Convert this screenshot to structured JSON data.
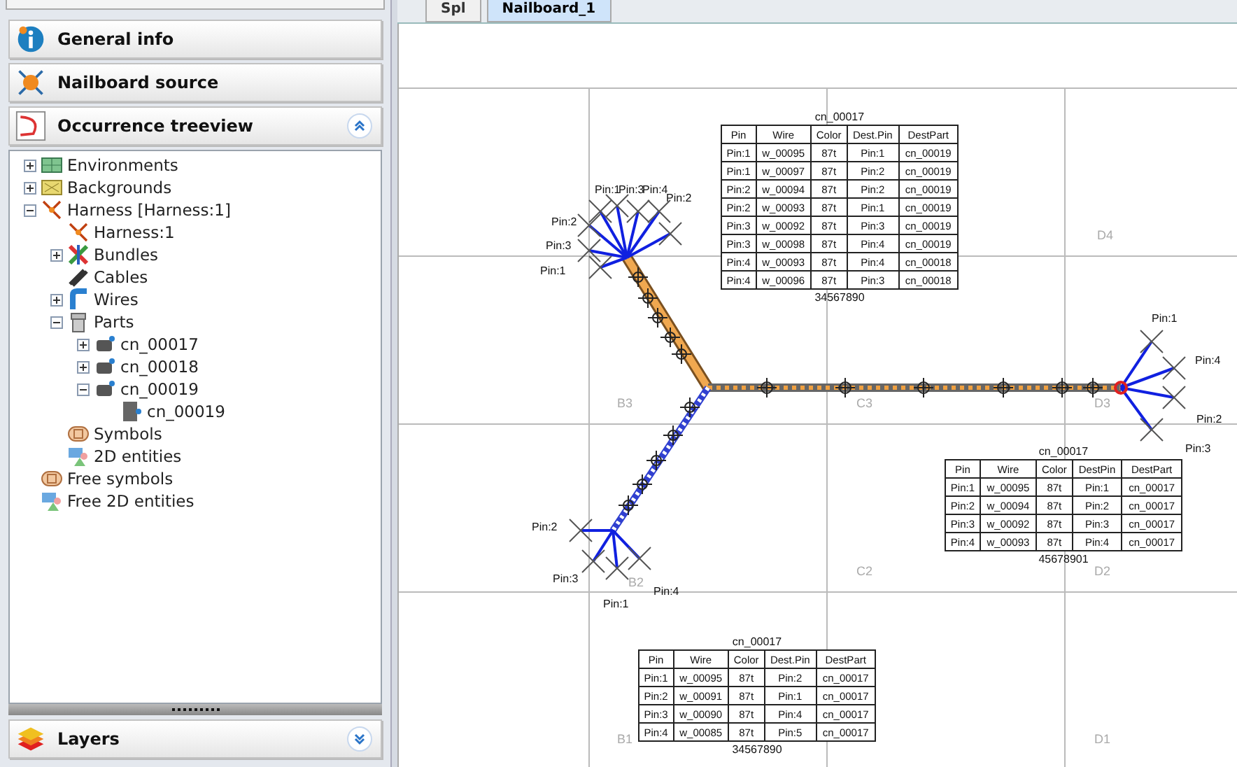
{
  "panel": {
    "sections": [
      {
        "kind": "info",
        "title": "General info"
      },
      {
        "kind": "source",
        "title": "Nailboard source"
      },
      {
        "kind": "tree",
        "title": "Occurrence treeview",
        "expanded": true
      }
    ],
    "footer_sections": [
      {
        "kind": "layers",
        "title": "Layers",
        "expanded": false
      }
    ]
  },
  "tree": {
    "items": [
      {
        "kind": "environment",
        "label": "Environments",
        "expanded": false
      },
      {
        "kind": "background",
        "label": "Backgrounds",
        "expanded": false
      },
      {
        "kind": "harness",
        "label": "Harness [Harness:1]",
        "expanded": true,
        "children": [
          {
            "kind": "harness",
            "label": "Harness:1"
          },
          {
            "kind": "bundle",
            "label": "Bundles",
            "expanded": false
          },
          {
            "kind": "cable",
            "label": "Cables"
          },
          {
            "kind": "wire",
            "label": "Wires",
            "expanded": false
          },
          {
            "kind": "part",
            "label": "Parts",
            "expanded": true,
            "children": [
              {
                "kind": "connector",
                "label": "cn_00017",
                "expanded": false
              },
              {
                "kind": "connector",
                "label": "cn_00018",
                "expanded": false
              },
              {
                "kind": "connector",
                "label": "cn_00019",
                "expanded": true,
                "children": [
                  {
                    "kind": "pin",
                    "label": "cn_00019"
                  }
                ]
              }
            ]
          },
          {
            "kind": "symbol",
            "label": "Symbols"
          },
          {
            "kind": "entity",
            "label": "2D entities"
          }
        ]
      },
      {
        "kind": "symbol",
        "label": "Free symbols"
      },
      {
        "kind": "entity",
        "label": "Free 2D entities"
      }
    ]
  },
  "tabs": [
    {
      "label": "Spl",
      "selected": false
    },
    {
      "label": "Nailboard_1",
      "selected": true
    }
  ],
  "drawing": {
    "zone_labels": [
      "D4",
      "B3",
      "C3",
      "D3",
      "B2",
      "C2",
      "D2",
      "B1",
      "D1"
    ],
    "connectors": [
      {
        "pin_labels": [
          "Pin:1",
          "Pin:3",
          "Pin:4",
          "Pin:2",
          "Pin:2",
          "Pin:3",
          "Pin:1"
        ]
      },
      {
        "pin_labels": [
          "Pin:1",
          "Pin:4",
          "Pin:2",
          "Pin:3"
        ]
      },
      {
        "pin_labels": [
          "Pin:2",
          "Pin:3",
          "Pin:4",
          "Pin:1"
        ]
      }
    ],
    "tables": [
      {
        "title": "cn_00017",
        "columns": [
          "Pin",
          "Wire",
          "Color",
          "Dest.Pin",
          "DestPart"
        ],
        "rows": [
          [
            "Pin:1",
            "w_00095",
            "87t",
            "Pin:1",
            "cn_00019"
          ],
          [
            "Pin:1",
            "w_00097",
            "87t",
            "Pin:2",
            "cn_00019"
          ],
          [
            "Pin:2",
            "w_00094",
            "87t",
            "Pin:2",
            "cn_00019"
          ],
          [
            "Pin:2",
            "w_00093",
            "87t",
            "Pin:1",
            "cn_00019"
          ],
          [
            "Pin:3",
            "w_00092",
            "87t",
            "Pin:3",
            "cn_00019"
          ],
          [
            "Pin:3",
            "w_00098",
            "87t",
            "Pin:4",
            "cn_00019"
          ],
          [
            "Pin:4",
            "w_00093",
            "87t",
            "Pin:4",
            "cn_00018"
          ],
          [
            "Pin:4",
            "w_00096",
            "87t",
            "Pin:3",
            "cn_00018"
          ]
        ],
        "footer": "34567890"
      },
      {
        "title": "cn_00017",
        "columns": [
          "Pin",
          "Wire",
          "Color",
          "DestPin",
          "DestPart"
        ],
        "rows": [
          [
            "Pin:1",
            "w_00095",
            "87t",
            "Pin:1",
            "cn_00017"
          ],
          [
            "Pin:2",
            "w_00094",
            "87t",
            "Pin:2",
            "cn_00017"
          ],
          [
            "Pin:3",
            "w_00092",
            "87t",
            "Pin:3",
            "cn_00017"
          ],
          [
            "Pin:4",
            "w_00093",
            "87t",
            "Pin:4",
            "cn_00017"
          ]
        ],
        "footer": "45678901"
      },
      {
        "title": "cn_00017",
        "columns": [
          "Pin",
          "Wire",
          "Color",
          "Dest.Pin",
          "DestPart"
        ],
        "rows": [
          [
            "Pin:1",
            "w_00095",
            "87t",
            "Pin:2",
            "cn_00017"
          ],
          [
            "Pin:2",
            "w_00091",
            "87t",
            "Pin:1",
            "cn_00017"
          ],
          [
            "Pin:3",
            "w_00090",
            "87t",
            "Pin:4",
            "cn_00017"
          ],
          [
            "Pin:4",
            "w_00085",
            "87t",
            "Pin:5",
            "cn_00017"
          ]
        ],
        "footer": "34567890"
      }
    ]
  }
}
